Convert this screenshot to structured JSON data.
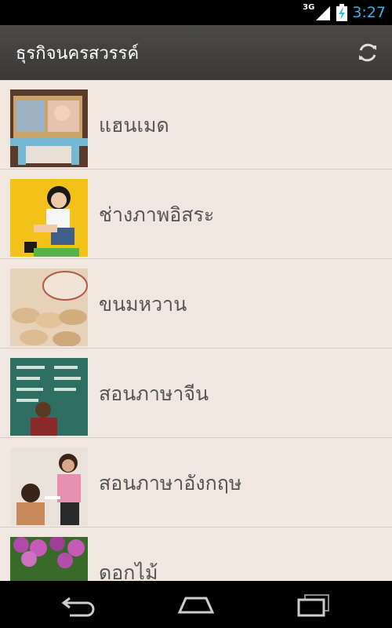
{
  "status": {
    "network": "3G",
    "time": "3:27"
  },
  "app": {
    "title": "ธุรกิจนครสวรรค์"
  },
  "categories": [
    {
      "label": "แฮนเมด",
      "thumbnail": "handmade-photo"
    },
    {
      "label": "ช่างภาพอิสระ",
      "thumbnail": "photographer-photo"
    },
    {
      "label": "ขนมหวาน",
      "thumbnail": "dessert-photo"
    },
    {
      "label": "สอนภาษาจีน",
      "thumbnail": "chinese-class-photo"
    },
    {
      "label": "สอนภาษาอังกฤษ",
      "thumbnail": "english-class-photo"
    },
    {
      "label": "ดอกไม้",
      "thumbnail": "flowers-photo"
    }
  ],
  "colors": {
    "clock": "#33b5e5",
    "list_background": "#f2e6e1",
    "action_bar": "#42413f"
  }
}
